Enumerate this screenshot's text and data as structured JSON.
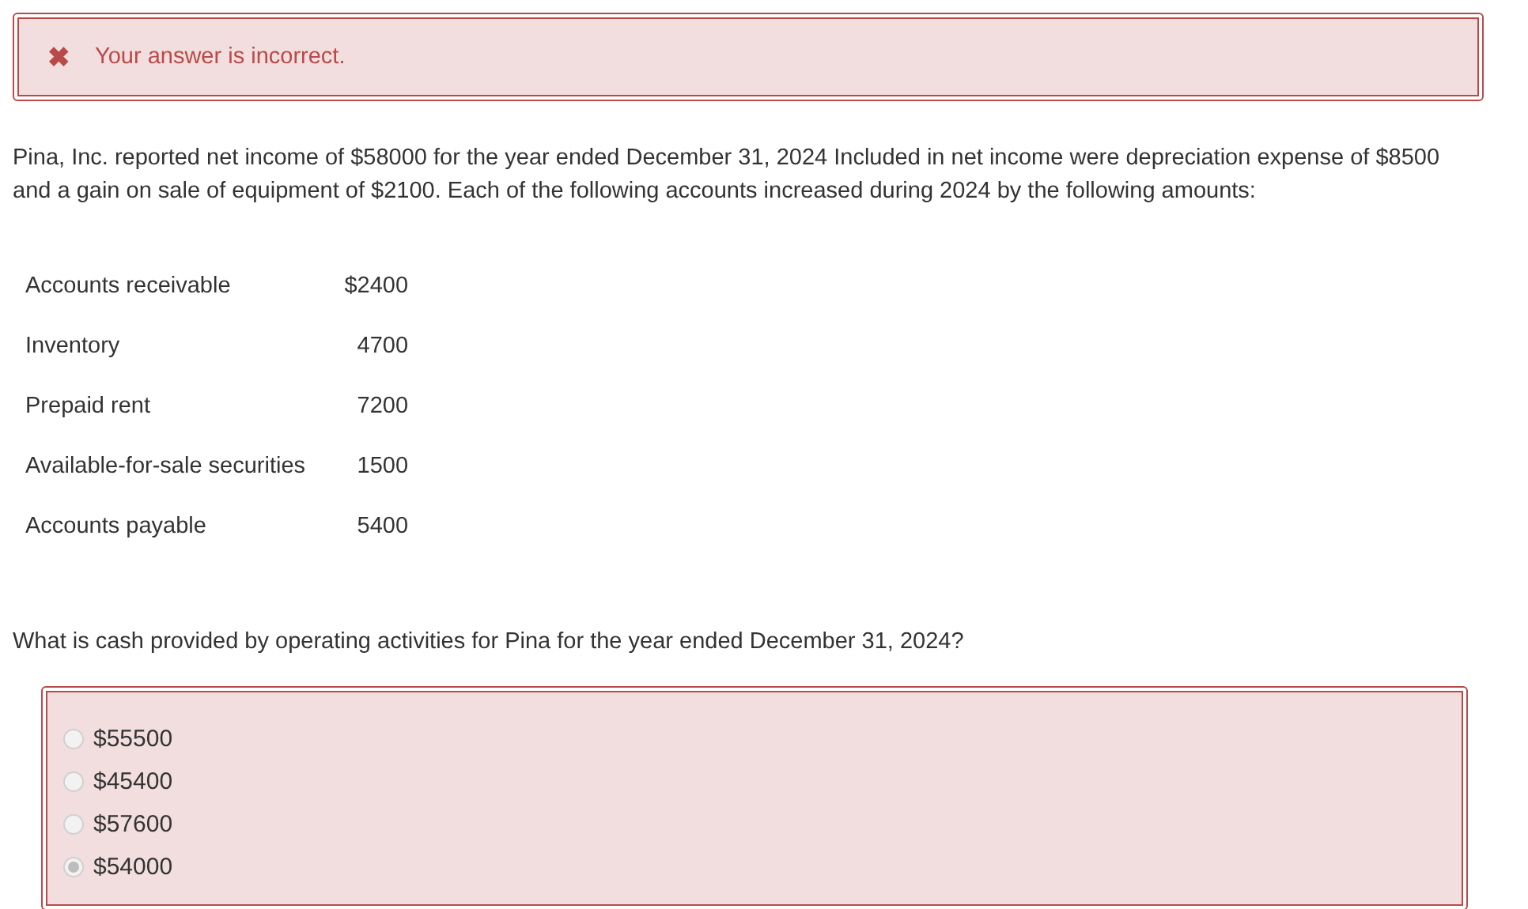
{
  "feedback": {
    "kind": "incorrect",
    "icon": "✖",
    "message": "Your answer is incorrect."
  },
  "question_text": "Pina, Inc. reported net income of $58000 for the year ended December 31, 2024 Included in net income were depreciation expense of $8500 and a gain on sale of equipment of $2100. Each of the following accounts increased during 2024 by the following amounts:",
  "accounts": [
    {
      "name": "Accounts receivable",
      "amount": "$2400"
    },
    {
      "name": "Inventory",
      "amount": "4700"
    },
    {
      "name": "Prepaid rent",
      "amount": "7200"
    },
    {
      "name": "Available-for-sale securities",
      "amount": "1500"
    },
    {
      "name": "Accounts payable",
      "amount": "5400"
    }
  ],
  "prompt": "What is cash provided by operating activities for Pina for the year ended December 31, 2024?",
  "answer_box": {
    "correct": false
  },
  "choices": [
    {
      "label": "$55500",
      "selected": false
    },
    {
      "label": "$45400",
      "selected": false
    },
    {
      "label": "$57600",
      "selected": false
    },
    {
      "label": "$54000",
      "selected": true
    }
  ]
}
